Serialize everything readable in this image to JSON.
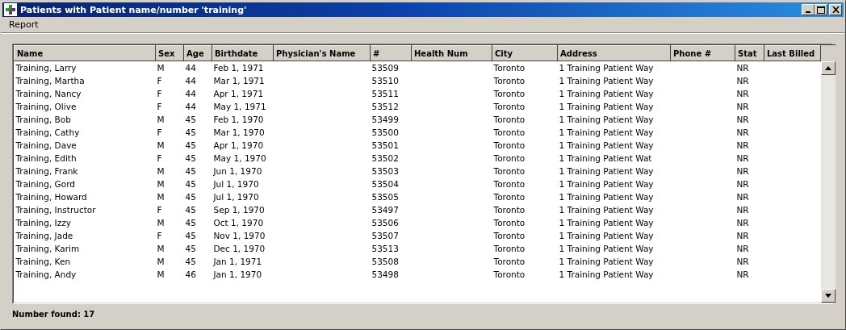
{
  "window": {
    "title": "Patients with Patient name/number 'training'"
  },
  "menu": [
    {
      "label": "Report"
    }
  ],
  "table": {
    "columns": [
      {
        "label": "Name"
      },
      {
        "label": "Sex"
      },
      {
        "label": "Age"
      },
      {
        "label": "Birthdate"
      },
      {
        "label": "Physician's Name"
      },
      {
        "label": "#"
      },
      {
        "label": "Health Num"
      },
      {
        "label": "City"
      },
      {
        "label": "Address"
      },
      {
        "label": "Phone #"
      },
      {
        "label": "Stat"
      },
      {
        "label": "Last Billed"
      }
    ],
    "rows": [
      {
        "name": "Training, Larry",
        "sex": "M",
        "age": "44",
        "birthdate": "Feb 1, 1971",
        "number": "53509",
        "city": "Toronto",
        "address": "1 Training Patient Way",
        "stat": "NR"
      },
      {
        "name": "Training, Martha",
        "sex": "F",
        "age": "44",
        "birthdate": "Mar 1, 1971",
        "number": "53510",
        "city": "Toronto",
        "address": "1 Training Patient Way",
        "stat": "NR"
      },
      {
        "name": "Training, Nancy",
        "sex": "F",
        "age": "44",
        "birthdate": "Apr 1, 1971",
        "number": "53511",
        "city": "Toronto",
        "address": "1 Training Patient Way",
        "stat": "NR"
      },
      {
        "name": "Training, Olive",
        "sex": "F",
        "age": "44",
        "birthdate": "May 1, 1971",
        "number": "53512",
        "city": "Toronto",
        "address": "1 Training Patient Way",
        "stat": "NR"
      },
      {
        "name": "Training, Bob",
        "sex": "M",
        "age": "45",
        "birthdate": "Feb 1, 1970",
        "number": "53499",
        "city": "Toronto",
        "address": "1 Training Patient Way",
        "stat": "NR"
      },
      {
        "name": "Training, Cathy",
        "sex": "F",
        "age": "45",
        "birthdate": "Mar 1, 1970",
        "number": "53500",
        "city": "Toronto",
        "address": "1 Training Patient Way",
        "stat": "NR"
      },
      {
        "name": "Training, Dave",
        "sex": "M",
        "age": "45",
        "birthdate": "Apr 1, 1970",
        "number": "53501",
        "city": "Toronto",
        "address": "1 Training Patient Way",
        "stat": "NR"
      },
      {
        "name": "Training, Edith",
        "sex": "F",
        "age": "45",
        "birthdate": "May 1, 1970",
        "number": "53502",
        "city": "Toronto",
        "address": "1 Training Patient Wat",
        "stat": "NR"
      },
      {
        "name": "Training, Frank",
        "sex": "M",
        "age": "45",
        "birthdate": "Jun 1, 1970",
        "number": "53503",
        "city": "Toronto",
        "address": "1 Training Patient Way",
        "stat": "NR"
      },
      {
        "name": "Training, Gord",
        "sex": "M",
        "age": "45",
        "birthdate": "Jul 1, 1970",
        "number": "53504",
        "city": "Toronto",
        "address": "1 Training Patient Way",
        "stat": "NR"
      },
      {
        "name": "Training, Howard",
        "sex": "M",
        "age": "45",
        "birthdate": "Jul 1, 1970",
        "number": "53505",
        "city": "Toronto",
        "address": "1 Training Patient Way",
        "stat": "NR"
      },
      {
        "name": "Training, Instructor",
        "sex": "F",
        "age": "45",
        "birthdate": "Sep 1, 1970",
        "number": "53497",
        "city": "Toronto",
        "address": "1 Training Patient Way",
        "stat": "NR"
      },
      {
        "name": "Training, Izzy",
        "sex": "M",
        "age": "45",
        "birthdate": "Oct 1, 1970",
        "number": "53506",
        "city": "Toronto",
        "address": "1 Training Patient Way",
        "stat": "NR"
      },
      {
        "name": "Training, Jade",
        "sex": "F",
        "age": "45",
        "birthdate": "Nov 1, 1970",
        "number": "53507",
        "city": "Toronto",
        "address": "1 Training Patient Way",
        "stat": "NR"
      },
      {
        "name": "Training, Karim",
        "sex": "M",
        "age": "45",
        "birthdate": "Dec 1, 1970",
        "number": "53513",
        "city": "Toronto",
        "address": "1 Training Patient Way",
        "stat": "NR"
      },
      {
        "name": "Training, Ken",
        "sex": "M",
        "age": "45",
        "birthdate": "Jan 1, 1971",
        "number": "53508",
        "city": "Toronto",
        "address": "1 Training Patient Way",
        "stat": "NR"
      },
      {
        "name": "Training, Andy",
        "sex": "M",
        "age": "46",
        "birthdate": "Jan 1, 1970",
        "number": "53498",
        "city": "Toronto",
        "address": "1 Training Patient Way",
        "stat": "NR"
      }
    ]
  },
  "status_bar": {
    "text": "Number found: 17"
  }
}
